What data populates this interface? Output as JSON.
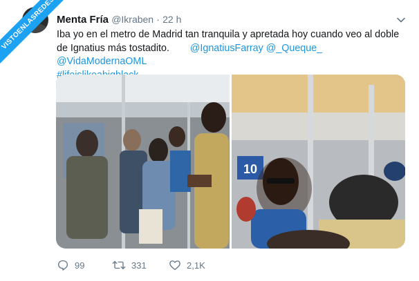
{
  "watermark": {
    "text": "VISTOENLASREDES"
  },
  "tweet": {
    "author_name": "Menta Fría",
    "author_handle": "@Ikraben",
    "separator": "·",
    "time": "22 h",
    "text_part1": "Iba yo en el metro de Madrid tan tranquila y apretada hoy cuando veo  al doble de Ignatius más tostadito.",
    "mentions": [
      "@IgnatiusFarray",
      "@_Queque_",
      "@VidaModernaOML"
    ],
    "hashtag": "#lifeislikeabigblack",
    "photo_sign_number": "10"
  },
  "actions": {
    "replies": "99",
    "retweets": "331",
    "likes": "2,1K"
  },
  "colors": {
    "accent": "#1da1f2",
    "link": "#1b95e0",
    "muted": "#657786",
    "text": "#14171a"
  },
  "icons": [
    "caret-down-icon",
    "reply-icon",
    "retweet-icon",
    "like-icon"
  ]
}
